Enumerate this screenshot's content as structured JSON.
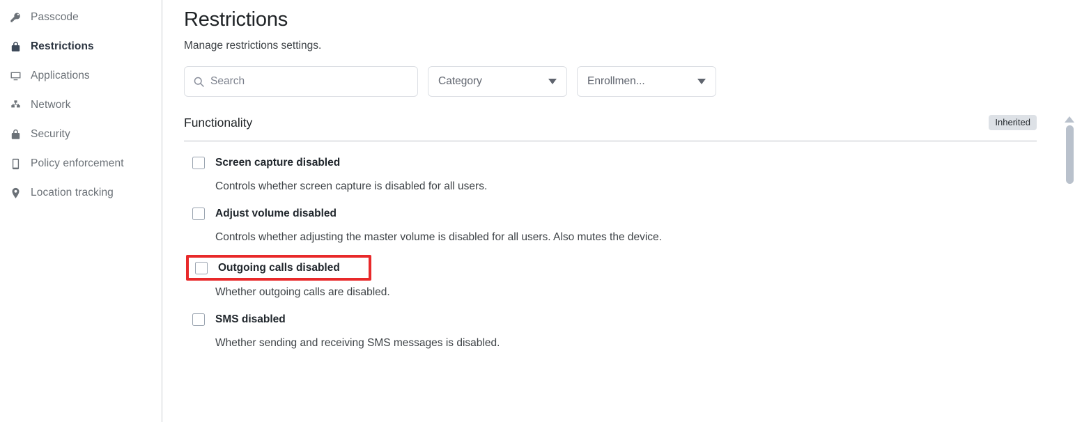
{
  "sidebar": {
    "items": [
      {
        "label": "Passcode",
        "icon": "key-icon",
        "active": false
      },
      {
        "label": "Restrictions",
        "icon": "lock-icon",
        "active": true
      },
      {
        "label": "Applications",
        "icon": "monitor-icon",
        "active": false
      },
      {
        "label": "Network",
        "icon": "network-icon",
        "active": false
      },
      {
        "label": "Security",
        "icon": "lock-icon",
        "active": false
      },
      {
        "label": "Policy enforcement",
        "icon": "mobile-device-icon",
        "active": false
      },
      {
        "label": "Location tracking",
        "icon": "map-pin-icon",
        "active": false
      }
    ]
  },
  "header": {
    "title": "Restrictions",
    "subtitle": "Manage restrictions settings."
  },
  "filters": {
    "search": {
      "placeholder": "Search",
      "value": ""
    },
    "category": {
      "label": "Category"
    },
    "enrollment": {
      "label": "Enrollmen..."
    }
  },
  "section": {
    "title": "Functionality",
    "badge": "Inherited"
  },
  "settings": [
    {
      "label": "Screen capture disabled",
      "description": "Controls whether screen capture is disabled for all users.",
      "checked": false,
      "highlighted": false
    },
    {
      "label": "Adjust volume disabled",
      "description": "Controls whether adjusting the master volume is disabled for all users. Also mutes the device.",
      "checked": false,
      "highlighted": false
    },
    {
      "label": "Outgoing calls disabled",
      "description": "Whether outgoing calls are disabled.",
      "checked": false,
      "highlighted": true
    },
    {
      "label": "SMS disabled",
      "description": "Whether sending and receiving SMS messages is disabled.",
      "checked": false,
      "highlighted": false
    }
  ],
  "colors": {
    "highlight": "#e8292a",
    "badge_bg": "#dde1e6",
    "scrollbar": "#b9c1cc",
    "active_text": "#2b3440"
  }
}
